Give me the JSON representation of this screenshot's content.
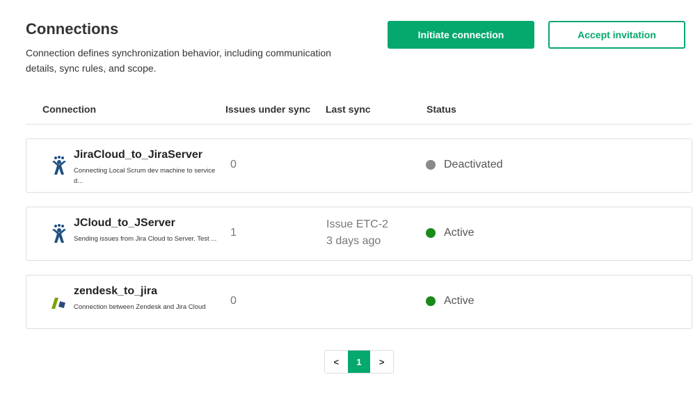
{
  "header": {
    "title": "Connections",
    "description": "Connection defines synchronization behavior, including communication details, sync rules, and scope.",
    "initiate_label": "Initiate connection",
    "accept_label": "Accept invitation"
  },
  "table": {
    "columns": [
      "Connection",
      "Issues under sync",
      "Last sync",
      "Status"
    ]
  },
  "connections": [
    {
      "name": "JiraCloud_to_JiraServer",
      "description": "Connecting Local Scrum dev machine to service d...",
      "issues": "0",
      "last_sync_line1": "",
      "last_sync_line2": "",
      "status": "Deactivated",
      "status_color": "#8a8a8a",
      "icon": "jira-icon"
    },
    {
      "name": "JCloud_to_JServer",
      "description": "Sending issues from Jira Cloud to Server. Test ...",
      "issues": "1",
      "last_sync_line1": "Issue ETC-2",
      "last_sync_line2": "3 days ago",
      "status": "Active",
      "status_color": "#1a8a1a",
      "icon": "jira-icon"
    },
    {
      "name": "zendesk_to_jira",
      "description": "Connection between Zendesk and Jira Cloud",
      "issues": "0",
      "last_sync_line1": "",
      "last_sync_line2": "",
      "status": "Active",
      "status_color": "#1a8a1a",
      "icon": "zendesk-icon"
    }
  ],
  "pagination": {
    "prev": "<",
    "current": "1",
    "next": ">"
  },
  "colors": {
    "accent": "#05a86d",
    "jira_blue": "#205081",
    "zendesk_green": "#78a300",
    "zendesk_navy": "#1f73b7"
  }
}
